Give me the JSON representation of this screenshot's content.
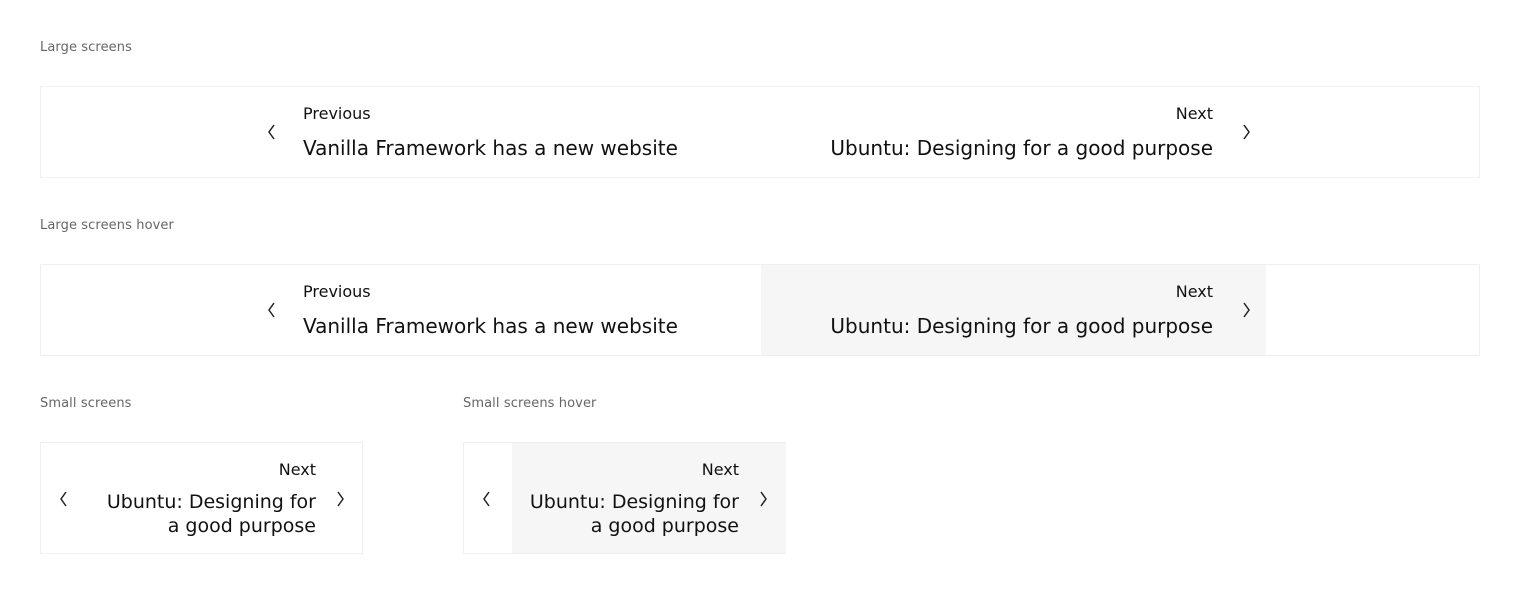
{
  "sections": {
    "large": {
      "label": "Large screens",
      "previous": {
        "eyebrow": "Previous",
        "title": "Vanilla Framework has a new website"
      },
      "next": {
        "eyebrow": "Next",
        "title": "Ubuntu: Designing for a good purpose"
      }
    },
    "large_hover": {
      "label": "Large screens hover",
      "previous": {
        "eyebrow": "Previous",
        "title": "Vanilla Framework has a new website"
      },
      "next": {
        "eyebrow": "Next",
        "title": "Ubuntu: Designing for a good purpose"
      }
    },
    "small": {
      "label": "Small screens",
      "next": {
        "eyebrow": "Next",
        "title": "Ubuntu: Designing for a good purpose"
      }
    },
    "small_hover": {
      "label": "Small screens hover",
      "next": {
        "eyebrow": "Next",
        "title": "Ubuntu: Designing for a good purpose"
      }
    }
  },
  "icons": {
    "previous": "chevron-left-icon",
    "next": "chevron-right-icon"
  },
  "colors": {
    "hover_background": "#f6f6f6",
    "border": "#efefef",
    "label_text": "#666666"
  }
}
